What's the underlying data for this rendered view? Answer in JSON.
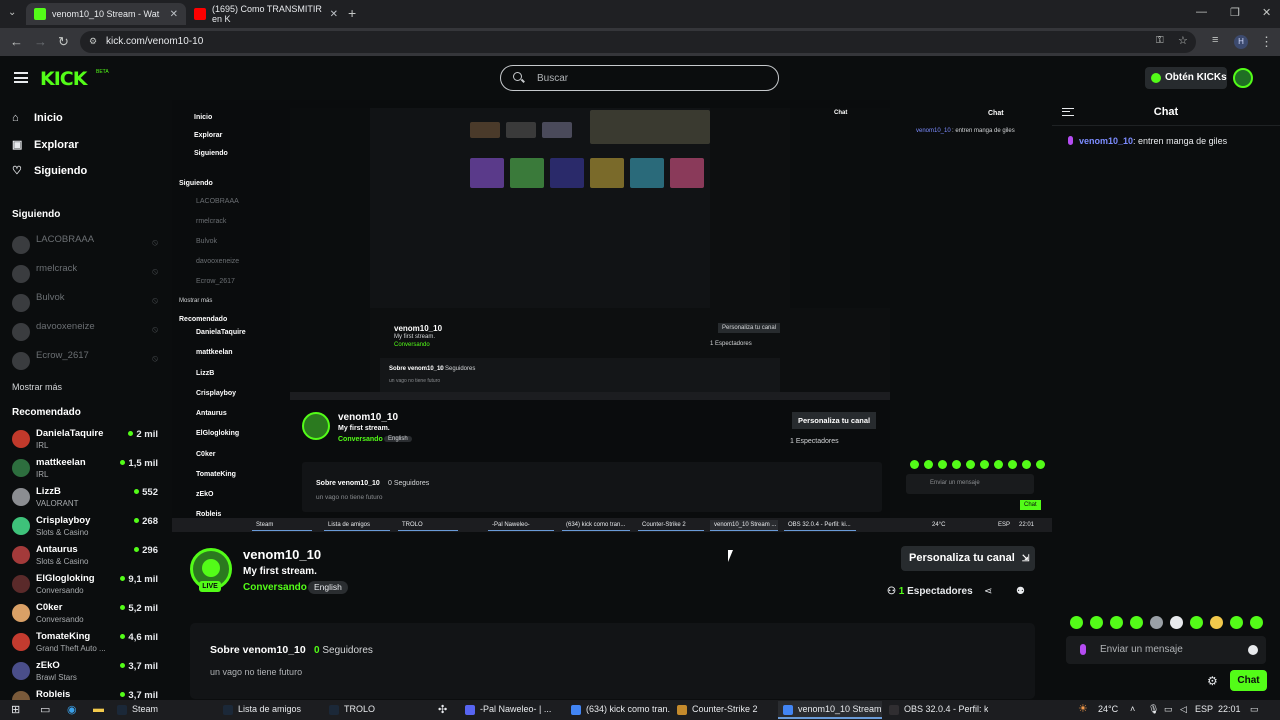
{
  "browser": {
    "tabs": [
      {
        "title": "venom10_10 Stream - Wat",
        "favicon_color": "#53fc18",
        "active": true
      },
      {
        "title": "(1695) Como TRANSMITIR en K",
        "favicon_color": "#ff0000",
        "active": false
      }
    ],
    "url": "kick.com/venom10-10",
    "profile_initial": "H"
  },
  "kick": {
    "logo": "KICK",
    "logo_badge": "BETA",
    "search_placeholder": "Buscar",
    "kicks_button": "Obtén KICKs"
  },
  "sidebar": {
    "nav": [
      {
        "label": "Inicio",
        "icon": "home-icon"
      },
      {
        "label": "Explorar",
        "icon": "compass-icon"
      },
      {
        "label": "Siguiendo",
        "icon": "heart-icon"
      }
    ],
    "following_title": "Siguiendo",
    "following": [
      {
        "name": "LACOBRAAA"
      },
      {
        "name": "rmelcrack"
      },
      {
        "name": "Bulvok"
      },
      {
        "name": "davooxeneize"
      },
      {
        "name": "Ecrow_2617"
      }
    ],
    "show_more": "Mostrar más",
    "recommended_title": "Recomendado",
    "recommended": [
      {
        "name": "DanielaTaquire",
        "category": "IRL",
        "viewers": "2 mil",
        "color": "#c0392b"
      },
      {
        "name": "mattkeelan",
        "category": "IRL",
        "viewers": "1,5 mil",
        "color": "#2d6e3e"
      },
      {
        "name": "LizzB",
        "category": "VALORANT",
        "viewers": "552",
        "color": "#8b8d91"
      },
      {
        "name": "Crisplayboy",
        "category": "Slots & Casino",
        "viewers": "268",
        "color": "#3ec27a"
      },
      {
        "name": "Antaurus",
        "category": "Slots & Casino",
        "viewers": "296",
        "color": "#a33a3a"
      },
      {
        "name": "ElGlogloking",
        "category": "Conversando",
        "viewers": "9,1 mil",
        "color": "#5a2a2a"
      },
      {
        "name": "C0ker",
        "category": "Conversando",
        "viewers": "5,2 mil",
        "color": "#d9a066"
      },
      {
        "name": "TomateKing",
        "category": "Grand Theft Auto ...",
        "viewers": "4,6 mil",
        "color": "#c33b2f"
      },
      {
        "name": "zEkO",
        "category": "Brawl Stars",
        "viewers": "3,7 mil",
        "color": "#4a4e8a"
      },
      {
        "name": "Robleis",
        "category": "",
        "viewers": "3,7 mil",
        "color": "#7a5a3a"
      }
    ]
  },
  "chat": {
    "title": "Chat",
    "message": {
      "user": "venom10_10",
      "text": ": entren manga de giles"
    },
    "input_placeholder": "Enviar un mensaje",
    "send_label": "Chat"
  },
  "stream": {
    "channel": "venom10_10",
    "title": "My first stream.",
    "category": "Conversando",
    "language": "English",
    "live_badge": "LIVE",
    "customize_button": "Personaliza tu canal",
    "viewers_count": "1",
    "viewers_label": "Espectadores",
    "about_title": "Sobre venom10_10",
    "followers_count": "0",
    "followers_label": "Seguidores",
    "bio": "un vago no tiene futuro"
  },
  "nested_small": {
    "chat_title": "Chat",
    "message_user": "venom10_10",
    "message_text": ": entren manga de giles",
    "channel": "venom10_10",
    "title": "My first stream.",
    "category": "Conversando",
    "language": "English",
    "customize_button": "Personaliza tu canal",
    "viewers": "1 Espectadores",
    "about_title": "Sobre venom10_10",
    "followers": "0 Seguidores",
    "bio": "un vago no tiene futuro",
    "input_placeholder": "Enviar un mensaje",
    "send_label": "Chat",
    "nav": [
      "Inicio",
      "Explorar",
      "Siguiendo"
    ],
    "following_title": "Siguiendo",
    "following": [
      "LACOBRAAA",
      "rmelcrack",
      "Bulvok",
      "davooxeneize",
      "Ecrow_2617"
    ],
    "show_more": "Mostrar más",
    "recommended_title": "Recomendado",
    "recommended": [
      {
        "name": "DanielaTaquire",
        "category": "IRL",
        "viewers": "2 mil"
      },
      {
        "name": "mattkeelan",
        "category": "IRL",
        "viewers": "1,5 mil"
      },
      {
        "name": "LizzB",
        "category": "VALORANT",
        "viewers": "552"
      },
      {
        "name": "Crisplayboy",
        "category": "Slots & Casino",
        "viewers": "268"
      },
      {
        "name": "Antaurus",
        "category": "Slots & Casino",
        "viewers": "296"
      },
      {
        "name": "ElGlogloking",
        "category": "Conversando",
        "viewers": "9,1 mil"
      },
      {
        "name": "C0ker",
        "category": "Conversando",
        "viewers": "5,2 mil"
      },
      {
        "name": "TomateKing",
        "category": "Grand Theft Auto ...",
        "viewers": "4,6 mil"
      },
      {
        "name": "zEkO",
        "category": "Brawl Stars",
        "viewers": "3,7 mil"
      },
      {
        "name": "Robleis",
        "category": "",
        "viewers": "3,7 mil"
      }
    ],
    "taskbar": [
      "Steam",
      "Lista de amigos",
      "TROLO",
      "-Pal Naweleo-",
      "(634) kick como tran...",
      "Counter-Strike 2",
      "venom10_10 Stream ...",
      "OBS 32.0.4 - Perfil: ki..."
    ],
    "tray_temp": "24°C",
    "tray_lang": "ESP",
    "tray_time": "22:01"
  },
  "taskbar": {
    "items": [
      {
        "label": "Steam",
        "color": "#1b2838",
        "active": false
      },
      {
        "label": "Lista de amigos",
        "color": "#1b2838",
        "active": false
      },
      {
        "label": "TROLO",
        "color": "#1b2838",
        "active": false
      },
      {
        "label": "-Pal Naweleo- | ...",
        "color": "#5865f2",
        "active": false
      },
      {
        "label": "(634) kick como tran...",
        "color": "#4285f4",
        "active": false
      },
      {
        "label": "Counter-Strike 2",
        "color": "#c48a2c",
        "active": false
      },
      {
        "label": "venom10_10 Stream ...",
        "color": "#4285f4",
        "active": true
      },
      {
        "label": "OBS 32.0.4 - Perfil: ki...",
        "color": "#302e31",
        "active": false
      }
    ],
    "temperature": "24°C",
    "language": "ESP",
    "time": "22:01"
  }
}
